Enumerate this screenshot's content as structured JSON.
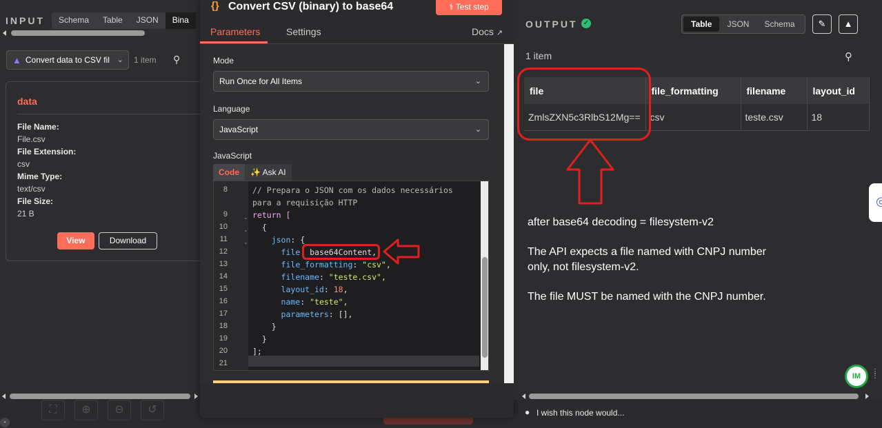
{
  "input": {
    "title": "INPUT",
    "tabs": [
      "Schema",
      "Table",
      "JSON",
      "Bina"
    ],
    "node_select": "Convert data to CSV fil",
    "item_count": "1 item",
    "card": {
      "title": "data",
      "fields": [
        {
          "label": "File Name:",
          "value": "File.csv"
        },
        {
          "label": "File Extension:",
          "value": "csv"
        },
        {
          "label": "Mime Type:",
          "value": "text/csv"
        },
        {
          "label": "File Size:",
          "value": "21 B"
        }
      ],
      "view_label": "View",
      "download_label": "Download"
    }
  },
  "node": {
    "title_icon": "{}",
    "title": "Convert CSV (binary) to base64",
    "test_step": "Test step",
    "tabs": {
      "parameters": "Parameters",
      "settings": "Settings",
      "docs": "Docs"
    },
    "mode_label": "Mode",
    "mode_value": "Run Once for All Items",
    "language_label": "Language",
    "language_value": "JavaScript",
    "code_label": "JavaScript",
    "code_tabs": {
      "code": "Code",
      "ask_ai": "Ask AI"
    },
    "line_numbers": [
      "8",
      "",
      "9",
      "10",
      "11",
      "12",
      "13",
      "14",
      "15",
      "16",
      "17",
      "18",
      "19",
      "20",
      "21"
    ],
    "code": {
      "l8a": "// Prepara o JSON com os dados necessários",
      "l8b": "para a requisição HTTP",
      "l9": "return [",
      "l10": "  {",
      "l11_key": "json",
      "l12_key": "file",
      "l12_val": "base64Content,",
      "l13_key": "file_formatting",
      "l13_val": "\"csv\",",
      "l14_key": "filename",
      "l14_val": "\"teste.csv\",",
      "l15_key": "layout_id",
      "l15_val": "18",
      "l16_key": "name",
      "l16_val": "\"teste\",",
      "l17_key": "parameters",
      "l17_val": "[],",
      "l18": "    }",
      "l19": "  }",
      "l20": "];"
    }
  },
  "output": {
    "title": "OUTPUT",
    "tabs": [
      "Table",
      "JSON",
      "Schema"
    ],
    "item_count": "1 item",
    "columns": [
      "file",
      "file_formatting",
      "filename",
      "layout_id"
    ],
    "row": [
      "ZmlsZXN5c3RlbS12Mg==",
      "csv",
      "teste.csv",
      "18"
    ]
  },
  "notes": {
    "n1": "after base64 decoding = filesystem-v2",
    "n2": "The API expects a file named with CNPJ number only, not filesystem-v2.",
    "n3": "The file MUST be named with the CNPJ number."
  },
  "bottom": {
    "hint": "I wish this node would..."
  },
  "fab_label": "IM",
  "colors": {
    "accent": "#ff6d5a",
    "annotation_red": "#e02020",
    "success": "#2fbf71"
  }
}
